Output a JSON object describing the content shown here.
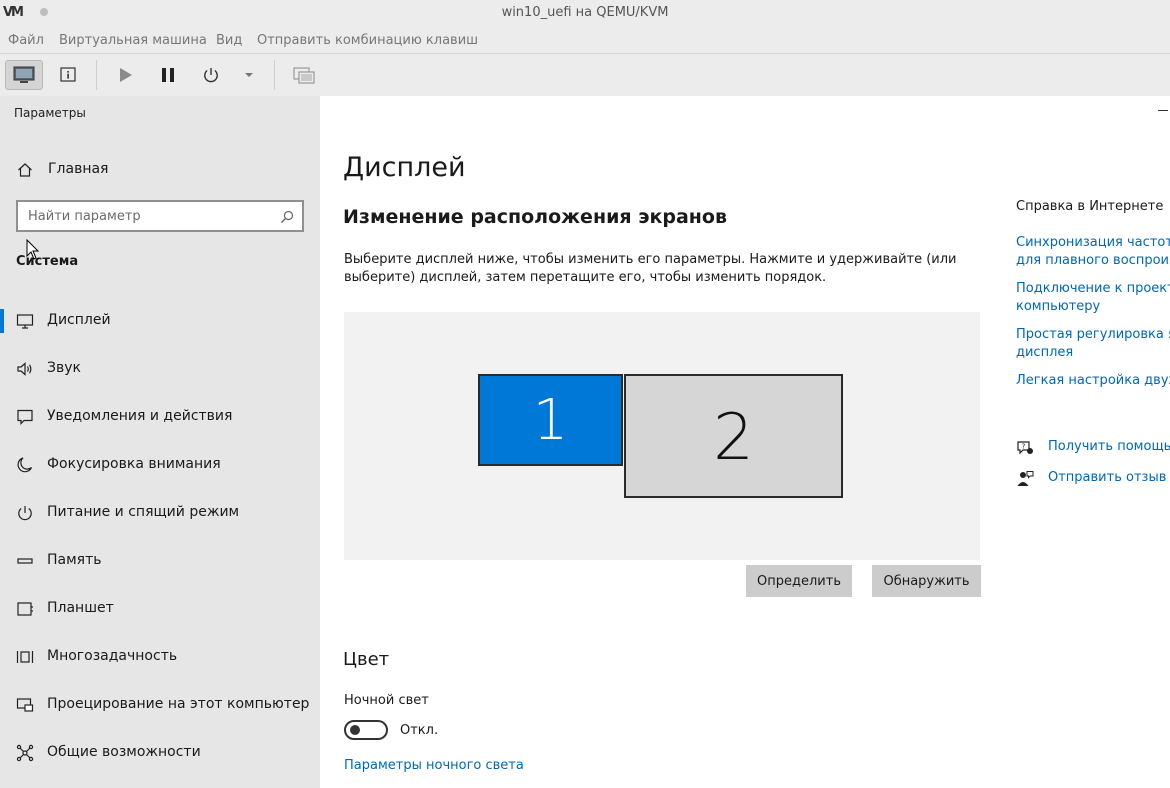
{
  "window": {
    "logo": "VM",
    "title": "win10_uefi на QEMU/KVM"
  },
  "menubar": {
    "items": [
      "Файл",
      "Виртуальная машина",
      "Вид",
      "Отправить комбинацию клавиш"
    ]
  },
  "toolbar": {
    "buttons": [
      "console-view",
      "details-view",
      "run",
      "pause",
      "shutdown",
      "shutdown-menu",
      "snapshots"
    ]
  },
  "sidebar": {
    "app_title": "Параметры",
    "home_label": "Главная",
    "search_placeholder": "Найти параметр",
    "section_title": "Система",
    "items": [
      {
        "label": "Дисплей",
        "icon": "monitor-icon",
        "selected": true
      },
      {
        "label": "Звук",
        "icon": "speaker-icon"
      },
      {
        "label": "Уведомления и действия",
        "icon": "notification-icon"
      },
      {
        "label": "Фокусировка внимания",
        "icon": "moon-icon"
      },
      {
        "label": "Питание и спящий режим",
        "icon": "power-icon"
      },
      {
        "label": "Память",
        "icon": "storage-icon"
      },
      {
        "label": "Планшет",
        "icon": "tablet-icon"
      },
      {
        "label": "Многозадачность",
        "icon": "multitasking-icon"
      },
      {
        "label": "Проецирование на этот компьютер",
        "icon": "projection-icon"
      },
      {
        "label": "Общие возможности",
        "icon": "shared-experiences-icon"
      }
    ]
  },
  "main": {
    "page_title": "Дисплей",
    "arrange_heading": "Изменение расположения экранов",
    "description": "Выберите дисплей ниже, чтобы изменить его параметры. Нажмите и удерживайте (или выберите) дисплей, затем перетащите его, чтобы изменить порядок.",
    "monitors": [
      {
        "number": "1",
        "selected": true
      },
      {
        "number": "2",
        "selected": false
      }
    ],
    "identify_button": "Определить",
    "detect_button": "Обнаружить",
    "color_heading": "Цвет",
    "night_light_label": "Ночной свет",
    "night_light_state": "Откл.",
    "night_light_on": false,
    "night_light_settings_link": "Параметры ночного света"
  },
  "help": {
    "title": "Справка в Интернете",
    "links": [
      "Синхронизация частот о",
      "для плавного воспроизв",
      "Подключение к проекто",
      "компьютеру",
      "Простая регулировка яр",
      "дисплея",
      "Легкая настройка двух м"
    ],
    "get_help": "Получить помощь",
    "feedback": "Отправить отзыв"
  },
  "colors": {
    "accent": "#0078d7",
    "link": "#0067b8",
    "sidebar_bg": "#e6e6e6",
    "chrome_bg": "#ececec"
  }
}
